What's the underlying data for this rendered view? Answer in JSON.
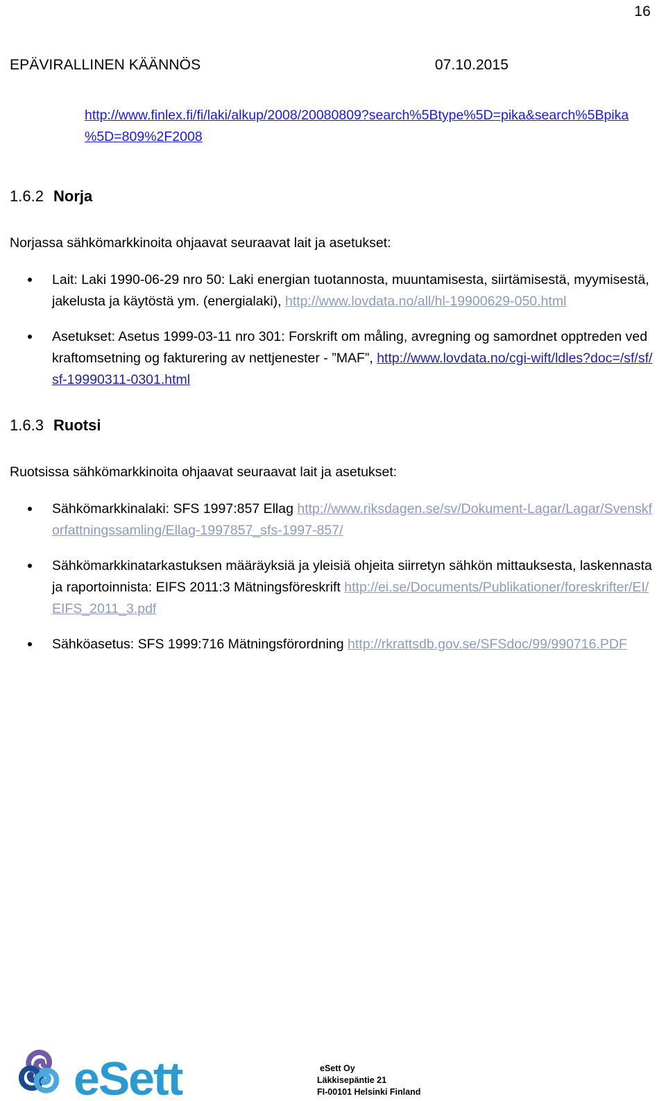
{
  "document": {
    "page_number": "16",
    "header_left": "EPÄVIRALLINEN KÄÄNNÖS",
    "header_right": "07.10.2015",
    "top_url": {
      "line1": "http://www.finlex.fi/fi/laki/alkup/2008/20080809?search%5Btype%5D=pika&search%5Bpika",
      "line2": "%5D=809%2F2008"
    }
  },
  "sections": [
    {
      "number": "1.6.2",
      "title": "Norja",
      "intro": "Norjassa sähkömarkkinoita ohjaavat seuraavat lait ja asetukset:",
      "bullets": [
        {
          "text": "Lait: Laki 1990-06-29 nro 50: Laki energian tuotannosta, muuntamisesta, siirtämisestä, myymisestä, jakelusta ja käytöstä ym. (energialaki), ",
          "link": "http://www.lovdata.no/all/hl-19900629-050.html",
          "link_style": "faded",
          "tail": ""
        },
        {
          "text": "Asetukset: Asetus 1999-03-11 nro 301: Forskrift om måling, avregning og samordnet opptreden ved kraftomsetning og fakturering av nettjenester - ”MAF”, ",
          "link": "http://www.lovdata.no/cgi-wift/ldles?doc=/sf/sf/sf-19990311-0301.html",
          "link_style": "dark",
          "tail": ""
        }
      ]
    },
    {
      "number": "1.6.3",
      "title": "Ruotsi",
      "intro": "Ruotsissa sähkömarkkinoita ohjaavat seuraavat lait ja asetukset:",
      "bullets": [
        {
          "text": "Sähkömarkkinalaki: SFS 1997:857 Ellag ",
          "link": "http://www.riksdagen.se/sv/Dokument-Lagar/Lagar/Svenskforfattningssamling/Ellag-1997857_sfs-1997-857/",
          "link_style": "faded",
          "tail": ""
        },
        {
          "text": "Sähkömarkkinatarkastuksen määräyksiä ja yleisiä ohjeita siirretyn sähkön mittauksesta, laskennasta ja raportoinnista: EIFS 2011:3 Mätningsföreskrift ",
          "link": "http://ei.se/Documents/Publikationer/foreskrifter/EI/EIFS_2011_3.pdf",
          "link_style": "faded",
          "tail": ""
        },
        {
          "text": "Sähköasetus: SFS 1999:716 Mätningsförordning ",
          "link": "http://rkrattsdb.gov.se/SFSdoc/99/990716.PDF",
          "link_style": "faded",
          "tail": ""
        }
      ]
    }
  ],
  "footer": {
    "logo_wordmark": "eSett",
    "company": "eSett Oy",
    "street": "Läkkisepäntie 21",
    "city": "FI-00101 Helsinki Finland",
    "logo_colors": {
      "purple": "#6f5ba8",
      "blue_dark": "#1b4a8c",
      "blue_mid": "#2b7cc4",
      "blue_light": "#4aa8dd",
      "wordmark": "#2a9ad0"
    }
  }
}
